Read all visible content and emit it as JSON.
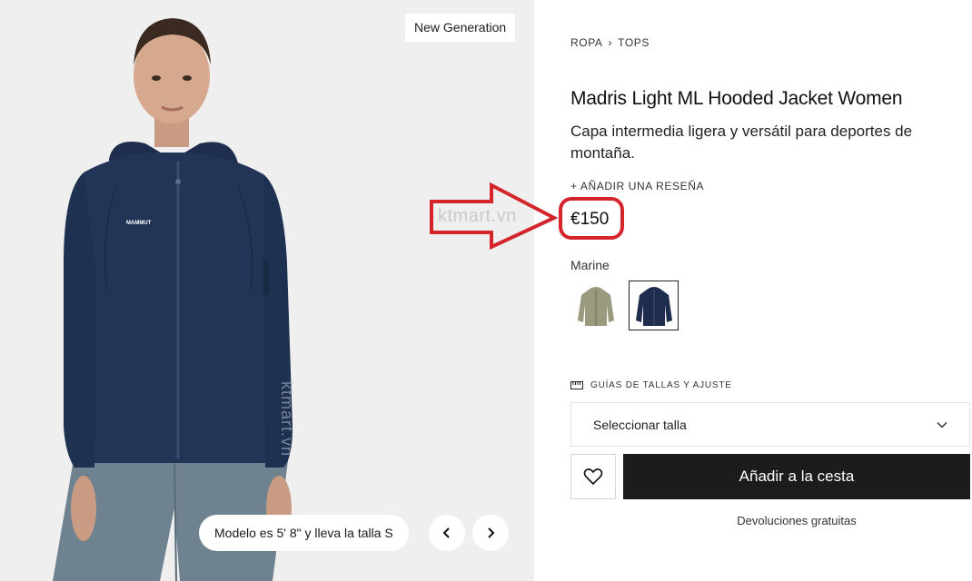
{
  "gallery": {
    "badge": "New Generation",
    "jacket_logo": "MAMMUT",
    "caption": "Modelo es 5' 8\" y lleva la talla S",
    "prev_icon": "chevron-left-icon",
    "next_icon": "chevron-right-icon"
  },
  "product": {
    "breadcrumb": [
      "ROPA",
      "TOPS"
    ],
    "title": "Madris Light ML Hooded Jacket Women",
    "subtitle": "Capa intermedia ligera y versátil para deportes de montaña.",
    "review_link": "+ AÑADIR UNA RESEÑA",
    "price": "€150",
    "color_label": "Marine",
    "swatches": [
      {
        "color": "#9a9a7e",
        "selected": false
      },
      {
        "color": "#1e2d4d",
        "selected": true
      }
    ],
    "size_guide": "GUÍAS DE TALLAS Y AJUSTE",
    "size_placeholder": "Seleccionar talla",
    "add_to_cart": "Añadir a la cesta",
    "returns": "Devoluciones gratuitas"
  },
  "annotation": {
    "watermark": "ktmart.vn",
    "highlight_color": "#d3252b"
  },
  "colors": {
    "jacket": "#223556",
    "pants": "#6f8290",
    "background": "#efefef",
    "cta": "#1c1c1c"
  }
}
